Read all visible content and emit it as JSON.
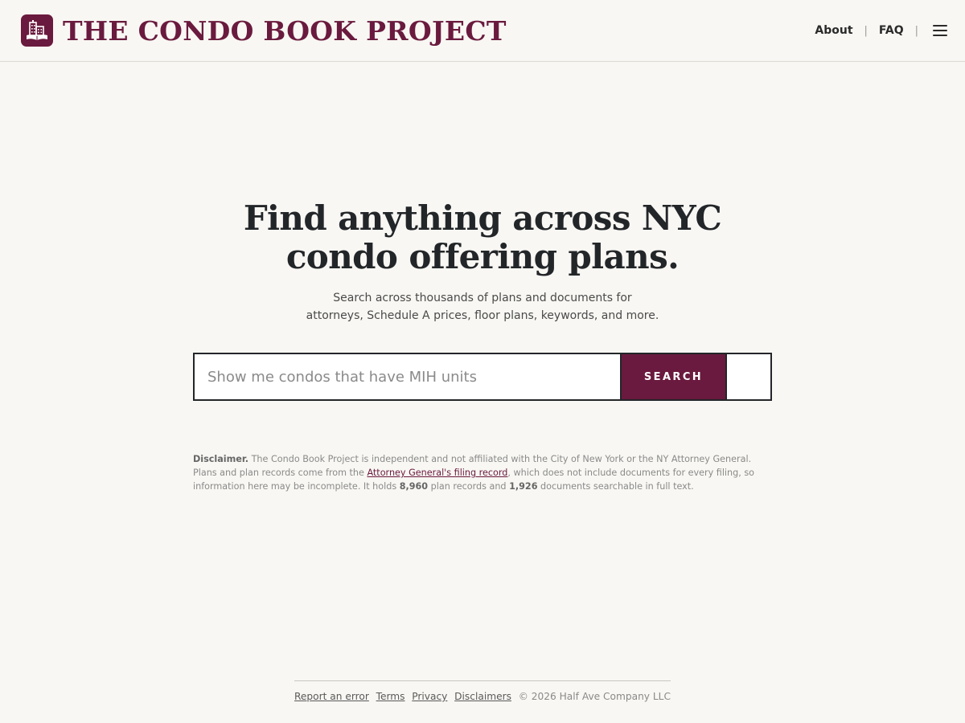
{
  "header": {
    "brand_name": "THE CONDO BOOK PROJECT",
    "logo_icon": "building-book-icon",
    "nav": {
      "about": "About",
      "faq": "FAQ",
      "separator": "|",
      "menu_icon": "hamburger-menu-icon"
    }
  },
  "hero": {
    "title_line1": "Find anything across NYC",
    "title_line2": "condo offering plans.",
    "subtitle_line1": "Search across thousands of plans and documents for",
    "subtitle_line2": "attorneys, Schedule A prices, floor plans, keywords, and more."
  },
  "search": {
    "placeholder": "Show me condos that have MIH units",
    "value": "",
    "button_label": "SEARCH"
  },
  "disclaimer": {
    "label": "Disclaimer.",
    "text1": " The Condo Book Project is independent and not affiliated with the City of New York or the NY Attorney General. Plans and plan records come from the ",
    "link": "Attorney General's filing record",
    "text2": ", which does not include documents for every filing, so information here may be incomplete. It holds ",
    "plan_count": "8,960",
    "text3": " plan records and ",
    "doc_count": "1,926",
    "text4": " documents searchable in full text."
  },
  "footer": {
    "report": "Report an error",
    "terms": "Terms",
    "privacy": "Privacy",
    "disclaimers": "Disclaimers",
    "copyright": "© 2026 Half Ave Company LLC"
  },
  "colors": {
    "brand": "#6a1a3e",
    "background": "#f8f7f3",
    "text": "#232629"
  }
}
